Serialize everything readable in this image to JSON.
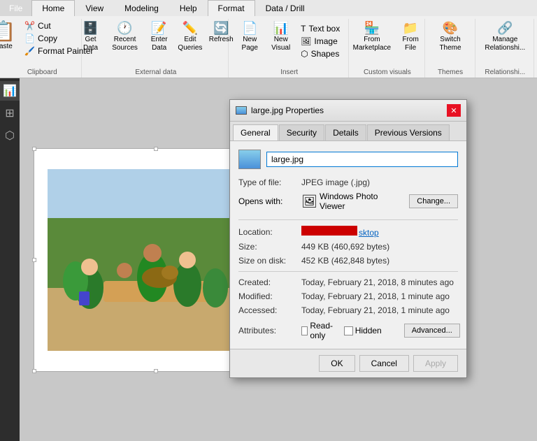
{
  "ribbon": {
    "tabs": [
      {
        "id": "file",
        "label": "File",
        "type": "file"
      },
      {
        "id": "home",
        "label": "Home",
        "active": true
      },
      {
        "id": "view",
        "label": "View"
      },
      {
        "id": "modeling",
        "label": "Modeling"
      },
      {
        "id": "help",
        "label": "Help"
      },
      {
        "id": "format",
        "label": "Format",
        "highlight": true
      },
      {
        "id": "datadrill",
        "label": "Data / Drill"
      }
    ],
    "clipboard": {
      "label": "Clipboard",
      "paste_label": "Paste",
      "cut_label": "Cut",
      "copy_label": "Copy",
      "format_painter_label": "Format Painter"
    },
    "external_data": {
      "label": "External data",
      "get_data": "Get Data",
      "recent_sources": "Recent Sources",
      "enter_data": "Enter Data",
      "edit_queries": "Edit Queries",
      "refresh": "Refresh"
    },
    "insert": {
      "label": "Insert",
      "new_page": "New Page",
      "new_visual": "New Visual",
      "text_box": "Text box",
      "image": "Image",
      "shapes": "Shapes"
    },
    "custom_visuals": {
      "label": "Custom visuals",
      "from_marketplace": "From Marketplace",
      "from_file": "From File"
    },
    "themes": {
      "label": "Themes",
      "switch_theme": "Switch Theme"
    },
    "relationships": {
      "label": "Relationshi...",
      "manage": "Manage Relationshi..."
    }
  },
  "dialog": {
    "title": "large.jpg Properties",
    "icon_alt": "file-icon",
    "tabs": [
      {
        "id": "general",
        "label": "General",
        "active": true
      },
      {
        "id": "security",
        "label": "Security"
      },
      {
        "id": "details",
        "label": "Details"
      },
      {
        "id": "previous_versions",
        "label": "Previous Versions"
      }
    ],
    "file_name": "large.jpg",
    "type_label": "Type of file:",
    "type_value": "JPEG image (.jpg)",
    "opens_label": "Opens with:",
    "opens_app": "Windows Photo Viewer",
    "change_btn": "Change...",
    "location_label": "Location:",
    "location_suffix": "sktop",
    "size_label": "Size:",
    "size_value": "449 KB (460,692 bytes)",
    "size_disk_label": "Size on disk:",
    "size_disk_value": "452 KB (462,848 bytes)",
    "created_label": "Created:",
    "created_value": "Today, February 21, 2018, 8 minutes ago",
    "modified_label": "Modified:",
    "modified_value": "Today, February 21, 2018, 1 minute ago",
    "accessed_label": "Accessed:",
    "accessed_value": "Today, February 21, 2018, 1 minute ago",
    "attributes_label": "Attributes:",
    "readonly_label": "Read-only",
    "hidden_label": "Hidden",
    "advanced_btn": "Advanced...",
    "ok_btn": "OK",
    "cancel_btn": "Cancel",
    "apply_btn": "Apply"
  },
  "sidebar": {
    "icons": [
      {
        "id": "report",
        "symbol": "📊"
      },
      {
        "id": "data",
        "symbol": "⊞"
      },
      {
        "id": "model",
        "symbol": "⬡"
      }
    ]
  }
}
